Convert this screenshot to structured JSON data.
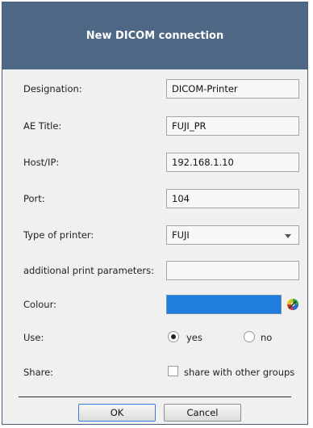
{
  "dialog": {
    "title": "New DICOM connection",
    "fields": {
      "designation": {
        "label": "Designation:",
        "value": "DICOM-Printer"
      },
      "ae_title": {
        "label": "AE Title:",
        "value": "FUJI_PR"
      },
      "host": {
        "label": "Host/IP:",
        "value": "192.168.1.10"
      },
      "port": {
        "label": "Port:",
        "value": "104"
      },
      "printer_type": {
        "label": "Type of printer:",
        "value": "FUJI"
      },
      "print_params": {
        "label": "additional print parameters:",
        "value": ""
      },
      "colour": {
        "label": "Colour:",
        "value": "#1f7ddb"
      },
      "use": {
        "label": "Use:",
        "yes_label": "yes",
        "no_label": "no",
        "selected": "yes"
      },
      "share": {
        "label": "Share:",
        "checkbox_label": "share with other groups",
        "checked": false
      }
    },
    "buttons": {
      "ok": "OK",
      "cancel": "Cancel"
    }
  }
}
